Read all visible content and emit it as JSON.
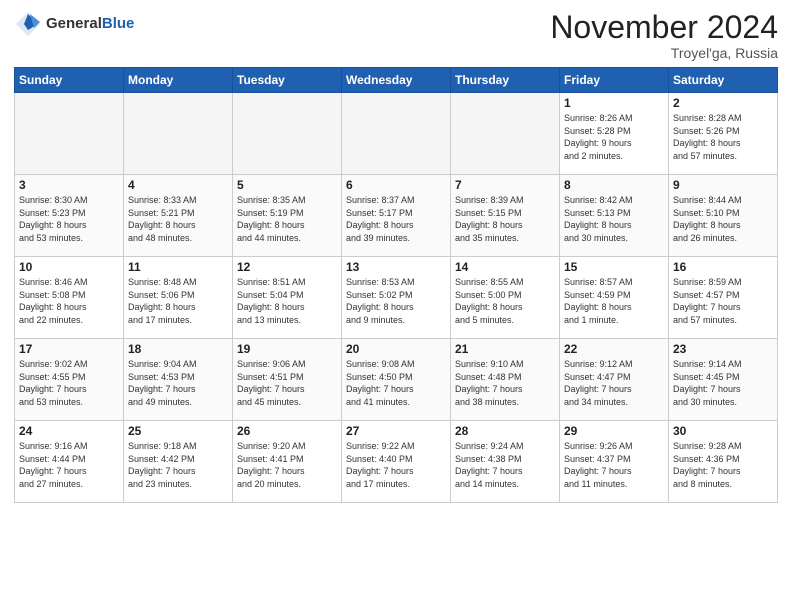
{
  "header": {
    "logo_general": "General",
    "logo_blue": "Blue",
    "month_title": "November 2024",
    "location": "Troyel'ga, Russia"
  },
  "days_of_week": [
    "Sunday",
    "Monday",
    "Tuesday",
    "Wednesday",
    "Thursday",
    "Friday",
    "Saturday"
  ],
  "weeks": [
    [
      {
        "day": "",
        "info": ""
      },
      {
        "day": "",
        "info": ""
      },
      {
        "day": "",
        "info": ""
      },
      {
        "day": "",
        "info": ""
      },
      {
        "day": "",
        "info": ""
      },
      {
        "day": "1",
        "info": "Sunrise: 8:26 AM\nSunset: 5:28 PM\nDaylight: 9 hours\nand 2 minutes."
      },
      {
        "day": "2",
        "info": "Sunrise: 8:28 AM\nSunset: 5:26 PM\nDaylight: 8 hours\nand 57 minutes."
      }
    ],
    [
      {
        "day": "3",
        "info": "Sunrise: 8:30 AM\nSunset: 5:23 PM\nDaylight: 8 hours\nand 53 minutes."
      },
      {
        "day": "4",
        "info": "Sunrise: 8:33 AM\nSunset: 5:21 PM\nDaylight: 8 hours\nand 48 minutes."
      },
      {
        "day": "5",
        "info": "Sunrise: 8:35 AM\nSunset: 5:19 PM\nDaylight: 8 hours\nand 44 minutes."
      },
      {
        "day": "6",
        "info": "Sunrise: 8:37 AM\nSunset: 5:17 PM\nDaylight: 8 hours\nand 39 minutes."
      },
      {
        "day": "7",
        "info": "Sunrise: 8:39 AM\nSunset: 5:15 PM\nDaylight: 8 hours\nand 35 minutes."
      },
      {
        "day": "8",
        "info": "Sunrise: 8:42 AM\nSunset: 5:13 PM\nDaylight: 8 hours\nand 30 minutes."
      },
      {
        "day": "9",
        "info": "Sunrise: 8:44 AM\nSunset: 5:10 PM\nDaylight: 8 hours\nand 26 minutes."
      }
    ],
    [
      {
        "day": "10",
        "info": "Sunrise: 8:46 AM\nSunset: 5:08 PM\nDaylight: 8 hours\nand 22 minutes."
      },
      {
        "day": "11",
        "info": "Sunrise: 8:48 AM\nSunset: 5:06 PM\nDaylight: 8 hours\nand 17 minutes."
      },
      {
        "day": "12",
        "info": "Sunrise: 8:51 AM\nSunset: 5:04 PM\nDaylight: 8 hours\nand 13 minutes."
      },
      {
        "day": "13",
        "info": "Sunrise: 8:53 AM\nSunset: 5:02 PM\nDaylight: 8 hours\nand 9 minutes."
      },
      {
        "day": "14",
        "info": "Sunrise: 8:55 AM\nSunset: 5:00 PM\nDaylight: 8 hours\nand 5 minutes."
      },
      {
        "day": "15",
        "info": "Sunrise: 8:57 AM\nSunset: 4:59 PM\nDaylight: 8 hours\nand 1 minute."
      },
      {
        "day": "16",
        "info": "Sunrise: 8:59 AM\nSunset: 4:57 PM\nDaylight: 7 hours\nand 57 minutes."
      }
    ],
    [
      {
        "day": "17",
        "info": "Sunrise: 9:02 AM\nSunset: 4:55 PM\nDaylight: 7 hours\nand 53 minutes."
      },
      {
        "day": "18",
        "info": "Sunrise: 9:04 AM\nSunset: 4:53 PM\nDaylight: 7 hours\nand 49 minutes."
      },
      {
        "day": "19",
        "info": "Sunrise: 9:06 AM\nSunset: 4:51 PM\nDaylight: 7 hours\nand 45 minutes."
      },
      {
        "day": "20",
        "info": "Sunrise: 9:08 AM\nSunset: 4:50 PM\nDaylight: 7 hours\nand 41 minutes."
      },
      {
        "day": "21",
        "info": "Sunrise: 9:10 AM\nSunset: 4:48 PM\nDaylight: 7 hours\nand 38 minutes."
      },
      {
        "day": "22",
        "info": "Sunrise: 9:12 AM\nSunset: 4:47 PM\nDaylight: 7 hours\nand 34 minutes."
      },
      {
        "day": "23",
        "info": "Sunrise: 9:14 AM\nSunset: 4:45 PM\nDaylight: 7 hours\nand 30 minutes."
      }
    ],
    [
      {
        "day": "24",
        "info": "Sunrise: 9:16 AM\nSunset: 4:44 PM\nDaylight: 7 hours\nand 27 minutes."
      },
      {
        "day": "25",
        "info": "Sunrise: 9:18 AM\nSunset: 4:42 PM\nDaylight: 7 hours\nand 23 minutes."
      },
      {
        "day": "26",
        "info": "Sunrise: 9:20 AM\nSunset: 4:41 PM\nDaylight: 7 hours\nand 20 minutes."
      },
      {
        "day": "27",
        "info": "Sunrise: 9:22 AM\nSunset: 4:40 PM\nDaylight: 7 hours\nand 17 minutes."
      },
      {
        "day": "28",
        "info": "Sunrise: 9:24 AM\nSunset: 4:38 PM\nDaylight: 7 hours\nand 14 minutes."
      },
      {
        "day": "29",
        "info": "Sunrise: 9:26 AM\nSunset: 4:37 PM\nDaylight: 7 hours\nand 11 minutes."
      },
      {
        "day": "30",
        "info": "Sunrise: 9:28 AM\nSunset: 4:36 PM\nDaylight: 7 hours\nand 8 minutes."
      }
    ]
  ]
}
